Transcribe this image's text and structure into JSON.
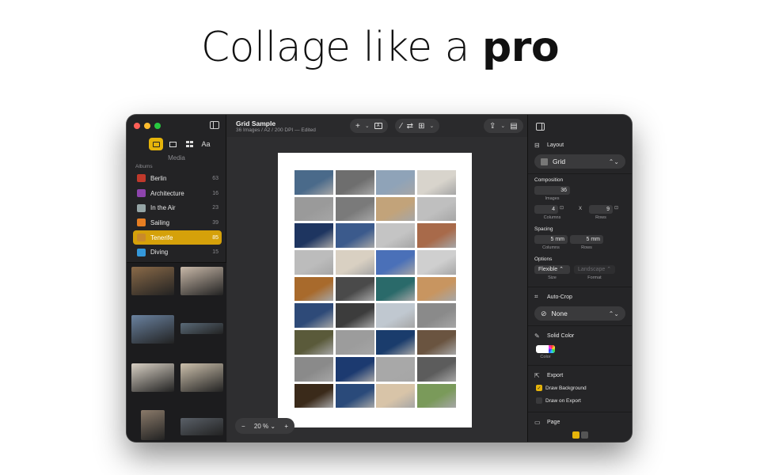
{
  "headline": {
    "light": "Collage like a ",
    "bold": "pro"
  },
  "sidebar": {
    "media_label": "Media",
    "media_tab_text": "Aa",
    "albums_label": "Albums",
    "albums": [
      {
        "name": "Berlin",
        "count": "63",
        "color": "#c0392b"
      },
      {
        "name": "Architecture",
        "count": "16",
        "color": "#8e44ad"
      },
      {
        "name": "In the Air",
        "count": "23",
        "color": "#95a5a6"
      },
      {
        "name": "Sailing",
        "count": "39",
        "color": "#e67e22"
      },
      {
        "name": "Tenerife",
        "count": "85",
        "color": "#c98a2a",
        "selected": true
      },
      {
        "name": "Diving",
        "count": "15",
        "color": "#3498db"
      }
    ]
  },
  "document": {
    "title": "Grid Sample",
    "subtitle": "36 Images / A2 / 200 DPI — Edited"
  },
  "toolbar": {
    "add_icon": "plus-icon",
    "text_icon": "text-box-icon",
    "magic_icon": "magic-wand-icon",
    "shuffle_icon": "shuffle-icon",
    "layout_icon": "layout-icon",
    "share_icon": "share-icon",
    "print_icon": "printer-icon"
  },
  "zoom": {
    "minus": "−",
    "value": "20 %",
    "plus": "+"
  },
  "inspector": {
    "layout": {
      "header": "Layout",
      "value": "Grid"
    },
    "composition": {
      "header": "Composition",
      "images": "36",
      "images_label": "Images",
      "columns": "4",
      "columns_label": "Columns",
      "x": "X",
      "rows": "9",
      "rows_label": "Rows"
    },
    "spacing": {
      "header": "Spacing",
      "columns": "5 mm",
      "columns_label": "Columns",
      "rows": "5 mm",
      "rows_label": "Rows"
    },
    "options": {
      "header": "Options",
      "size": "Flexible",
      "size_label": "Size",
      "format": "Landscape",
      "format_label": "Format"
    },
    "auto_crop": {
      "header": "Auto-Crop",
      "value": "None"
    },
    "solid_color": {
      "header": "Solid Color",
      "label": "Color",
      "color": "#ffffff"
    },
    "export": {
      "header": "Export",
      "draw_background": "Draw Background",
      "draw_background_checked": true,
      "draw_on_export": "Draw on Export",
      "draw_on_export_checked": false
    },
    "page": {
      "header": "Page"
    }
  },
  "collage_colors": [
    "#4a6a8a",
    "#6e6e6e",
    "#8fa3b8",
    "#d8d4cc",
    "#9a9a9a",
    "#7a7a7a",
    "#c2a37a",
    "#bfbfbf",
    "#1e3560",
    "#3b5a8c",
    "#c4c4c4",
    "#a86a4a",
    "#bcbcbc",
    "#d9d0c2",
    "#4a70b8",
    "#cfcfcf",
    "#a86a2c",
    "#4a4a4a",
    "#2a6a6a",
    "#c89560",
    "#2e4a78",
    "#3c3c3c",
    "#c0c8d0",
    "#8a8a8a",
    "#5a5a3a",
    "#9c9c9c",
    "#1a3c6c",
    "#6a5440",
    "#8a8a8a",
    "#1c3a70",
    "#a8a8a8",
    "#5c5c5c",
    "#3a2a1a",
    "#2a4a7a",
    "#d8c4a8",
    "#7a9a5a"
  ],
  "sidebar_thumb_colors": [
    "#8a6a48",
    "#c8b8a8",
    "#6a82a0",
    "#5a6a78",
    "#d8d0c4",
    "#ccc0ac",
    "#8a7a6a",
    "#5a6068"
  ]
}
